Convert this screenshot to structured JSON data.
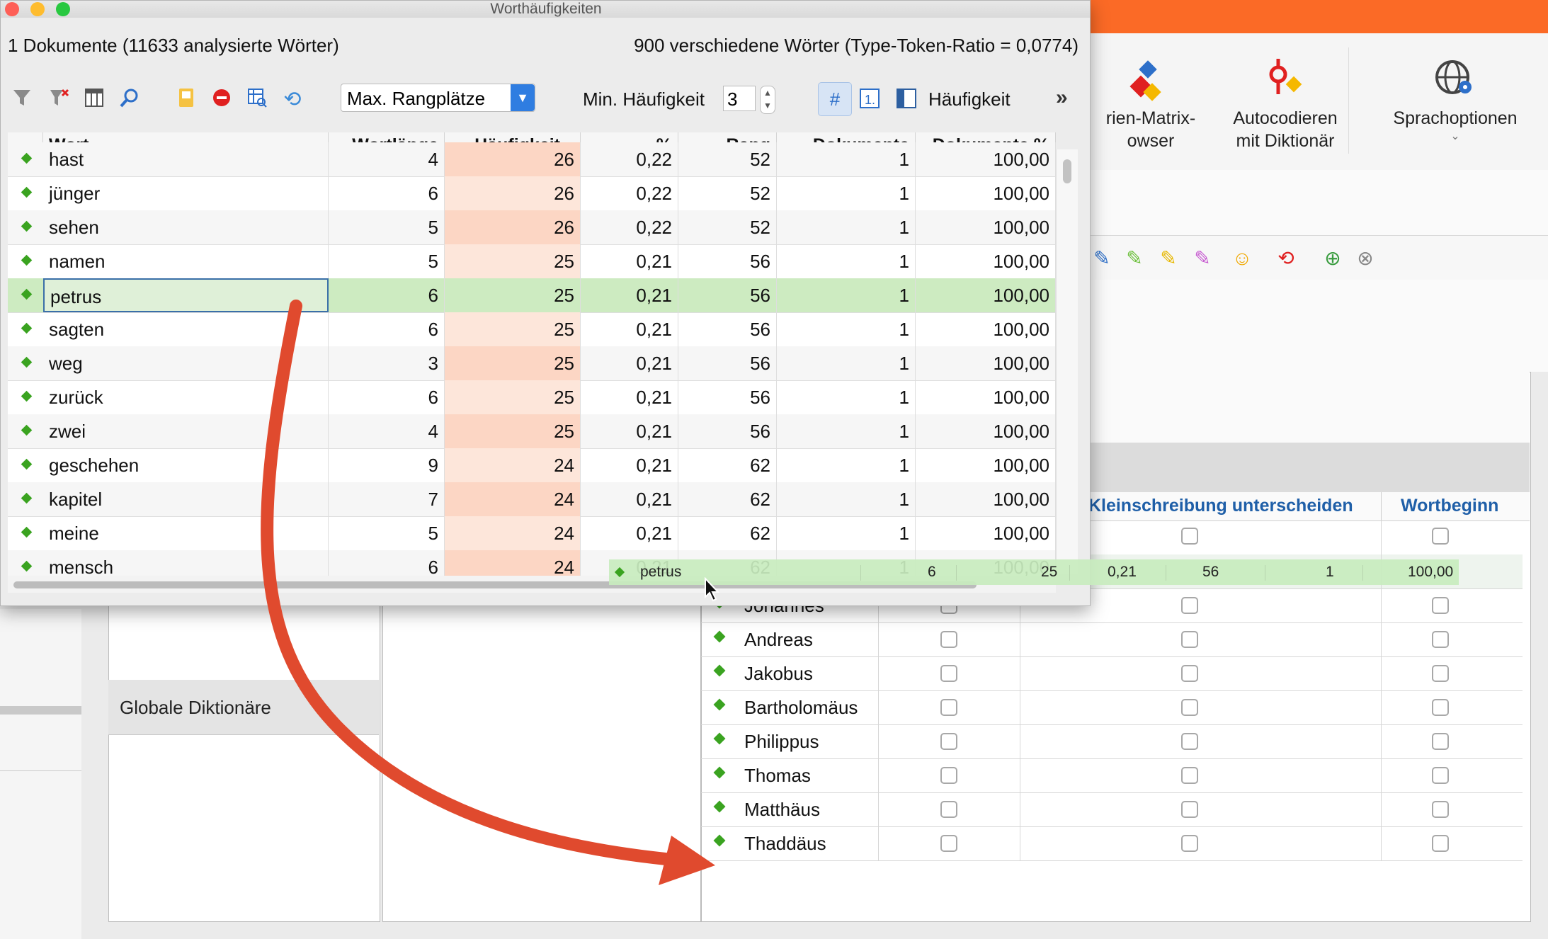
{
  "window": {
    "title": "Worthäufigkeiten",
    "info_left": "1 Dokumente (11633 analysierte Wörter)",
    "info_right": "900 verschiedene Wörter (Type-Token-Ratio = 0,0774)"
  },
  "toolbar": {
    "rank_select": "Max. Rangplätze",
    "min_freq_label": "Min. Häufigkeit",
    "min_freq_value": "3",
    "freq_label": "Häufigkeit",
    "more": "»"
  },
  "table": {
    "headers": [
      "Wort",
      "Wortlänge",
      "Häufigkeit",
      "%",
      "Rang",
      "Dokumente",
      "Dokumente %"
    ],
    "rows": [
      [
        "hast",
        "4",
        "26",
        "0,22",
        "52",
        "1",
        "100,00"
      ],
      [
        "jünger",
        "6",
        "26",
        "0,22",
        "52",
        "1",
        "100,00"
      ],
      [
        "sehen",
        "5",
        "26",
        "0,22",
        "52",
        "1",
        "100,00"
      ],
      [
        "namen",
        "5",
        "25",
        "0,21",
        "56",
        "1",
        "100,00"
      ],
      [
        "petrus",
        "6",
        "25",
        "0,21",
        "56",
        "1",
        "100,00"
      ],
      [
        "sagten",
        "6",
        "25",
        "0,21",
        "56",
        "1",
        "100,00"
      ],
      [
        "weg",
        "3",
        "25",
        "0,21",
        "56",
        "1",
        "100,00"
      ],
      [
        "zurück",
        "6",
        "25",
        "0,21",
        "56",
        "1",
        "100,00"
      ],
      [
        "zwei",
        "4",
        "25",
        "0,21",
        "56",
        "1",
        "100,00"
      ],
      [
        "geschehen",
        "9",
        "24",
        "0,21",
        "62",
        "1",
        "100,00"
      ],
      [
        "kapitel",
        "7",
        "24",
        "0,21",
        "62",
        "1",
        "100,00"
      ],
      [
        "meine",
        "5",
        "24",
        "0,21",
        "62",
        "1",
        "100,00"
      ],
      [
        "mensch",
        "6",
        "24",
        "0,21",
        "62",
        "1",
        "100,00"
      ]
    ],
    "selected_index": 4
  },
  "drag_ghost": {
    "word": "petrus",
    "values": [
      "6",
      "25",
      "0,21",
      "56",
      "1",
      "100,00"
    ]
  },
  "ribbon": {
    "item1": "rien-Matrix-\nowser",
    "item2": "Autocodieren\nmit Diktionär",
    "item3": "Sprachoptionen"
  },
  "dictionary": {
    "global_label": "Globale Diktionäre",
    "col_case": "/Kleinschreibung unterscheiden",
    "col_begin": "Wortbeginn",
    "words": [
      "Johannes",
      "Andreas",
      "Jakobus",
      "Bartholomäus",
      "Philippus",
      "Thomas",
      "Matthäus",
      "Thaddäus"
    ]
  },
  "colors": {
    "accent_orange": "#fb6a26",
    "selection_green": "#cdebc1",
    "freq_highlight": "#fcd6c4",
    "arrow_red": "#e04a2e",
    "header_blue": "#1f5fa8"
  }
}
